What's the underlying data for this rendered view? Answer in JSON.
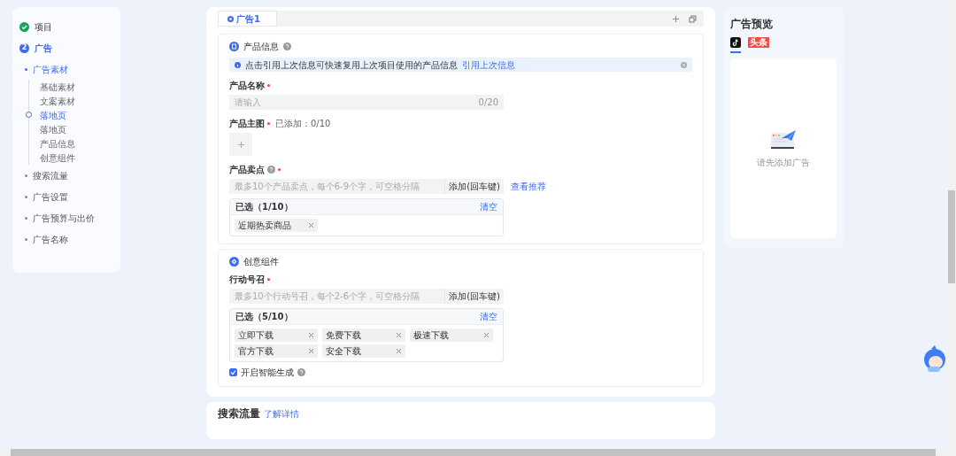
{
  "sidebar": {
    "steps": [
      {
        "kind": "done",
        "label": "项目"
      },
      {
        "kind": "current",
        "number": "2",
        "label": "广告",
        "children": [
          {
            "label": "广告素材",
            "selected": true,
            "children": [
              {
                "label": "基础素材",
                "selected": false
              },
              {
                "label": "文案素材",
                "selected": false
              },
              {
                "label": "落地页",
                "selected": true
              },
              {
                "label": "落地页",
                "selected": false
              },
              {
                "label": "产品信息",
                "selected": false
              },
              {
                "label": "创意组件",
                "selected": false
              }
            ]
          },
          {
            "label": "搜索流量",
            "selected": false
          },
          {
            "label": "广告设置",
            "selected": false
          },
          {
            "label": "广告预算与出价",
            "selected": false
          },
          {
            "label": "广告名称",
            "selected": false
          }
        ]
      }
    ]
  },
  "tabs": [
    {
      "label": "广告1",
      "selected": true
    }
  ],
  "product_info": {
    "title": "产品信息",
    "alert": {
      "text": "点击引用上次信息可快速复用上次项目使用的产品信息",
      "link": "引用上次信息"
    },
    "name_field": {
      "label": "产品名称",
      "required": true,
      "placeholder": "请输入",
      "counter": "0/20"
    },
    "main_image": {
      "label": "产品主图",
      "required": true,
      "note": "已添加：0/10"
    },
    "selling_points": {
      "label": "产品卖点",
      "required": true,
      "placeholder": "最多10个产品卖点，每个6-9个字，可空格分隔",
      "add_button": "添加(回车键)",
      "link": "查看推荐",
      "selected_title": "已选（1/10）",
      "clear": "清空",
      "tags": [
        "近期热卖商品"
      ]
    }
  },
  "creative": {
    "title": "创意组件",
    "cta": {
      "label": "行动号召",
      "required": true,
      "placeholder": "最多10个行动号召，每个2-6个字，可空格分隔",
      "add_button": "添加(回车键)",
      "selected_title": "已选（5/10）",
      "clear": "清空",
      "tags": [
        "立即下载",
        "免费下载",
        "极速下载",
        "官方下载",
        "安全下载"
      ]
    },
    "smart_generate": {
      "label": "开启智能生成",
      "checked": true
    }
  },
  "search_section": {
    "title": "搜索流量",
    "link": "了解详情"
  },
  "preview": {
    "title": "广告预览",
    "platforms": [
      {
        "kind": "douyin",
        "selected": true
      },
      {
        "kind": "toutiao",
        "label": "头条",
        "selected": false
      }
    ],
    "empty_text": "请先添加广告"
  }
}
